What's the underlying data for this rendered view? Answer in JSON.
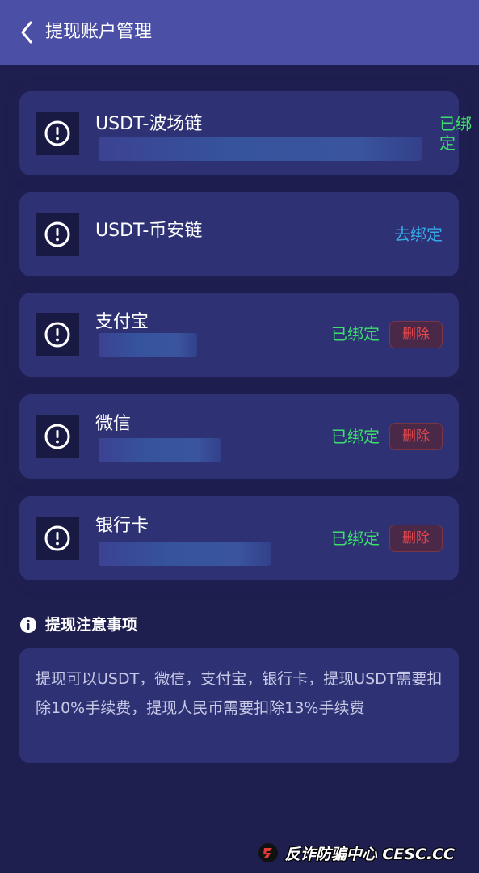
{
  "header": {
    "title": "提现账户管理"
  },
  "accounts": [
    {
      "name": "USDT-波场链",
      "status": "已绑定"
    },
    {
      "name": "USDT-币安链",
      "status": "去绑定"
    },
    {
      "name": "支付宝",
      "status": "已绑定",
      "delete_label": "删除"
    },
    {
      "name": "微信",
      "status": "已绑定",
      "delete_label": "删除"
    },
    {
      "name": "银行卡",
      "status": "已绑定",
      "delete_label": "删除"
    }
  ],
  "notice": {
    "title": "提现注意事项",
    "text": "提现可以USDT，微信，支付宝，银行卡，提现USDT需要扣除10%手续费，提现人民币需要扣除13%手续费"
  },
  "watermark": {
    "text": "反诈防骗中心 CESC.CC"
  },
  "colors": {
    "header_bg": "#4b4fa6",
    "page_bg": "#1f1f4f",
    "card_bg": "#2e3274",
    "bound": "#3be06a",
    "unbound": "#37a9e8",
    "delete": "#e2474c"
  },
  "icons": {
    "back": "chevron-left-icon",
    "account": "alert-circle-icon",
    "notice": "info-icon"
  }
}
